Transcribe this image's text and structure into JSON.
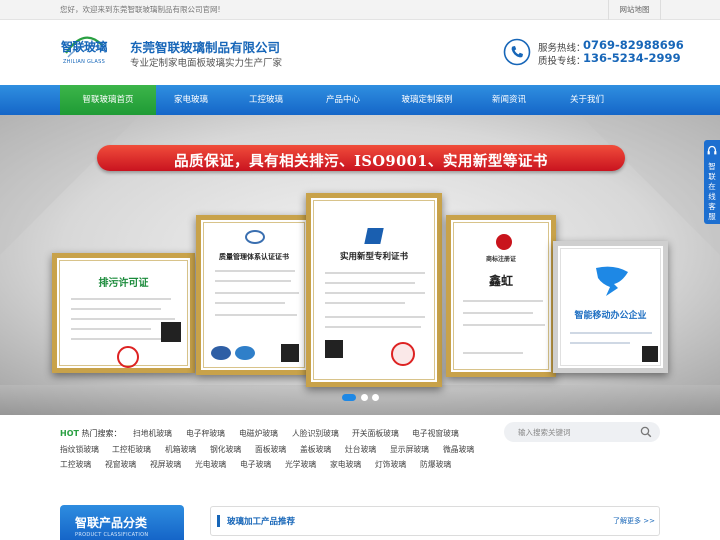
{
  "topbar": {
    "welcome": "您好，欢迎来到东莞智联玻璃制品有限公司官网!",
    "sitemap": "网站地图"
  },
  "header": {
    "logo_cn": "智联玻璃",
    "logo_en": "ZHILIAN GLASS",
    "company_name": "东莞智联玻璃制品有限公司",
    "slogan": "专业定制家电面板玻璃实力生产厂家",
    "hotline_label": "服务热线：",
    "hotline_number": "0769-82988696",
    "quality_label": "质投专线：",
    "quality_number": "136-5234-2999",
    "phone_icon": "phone-icon"
  },
  "nav": {
    "items": [
      {
        "label": "智联玻璃首页",
        "active": true
      },
      {
        "label": "家电玻璃"
      },
      {
        "label": "工控玻璃"
      },
      {
        "label": "产品中心"
      },
      {
        "label": "玻璃定制案例"
      },
      {
        "label": "新闻资讯"
      },
      {
        "label": "关于我们"
      }
    ]
  },
  "banner": {
    "title": "品质保证，具有相关排污、ISO9001、实用新型等证书",
    "certs": [
      {
        "title": "排污许可证"
      },
      {
        "title": "质量管理体系认证证书"
      },
      {
        "title": "实用新型专利证书"
      },
      {
        "title": "商标注册证",
        "mark": "鑫虹"
      },
      {
        "title": "智能移动办公企业"
      }
    ],
    "slide_count": 3,
    "active_slide": 1
  },
  "side_tab": {
    "label": "智联在线客服"
  },
  "hot_search": {
    "label_prefix": "HOT",
    "label_suffix": "热门搜索：",
    "rows": [
      [
        "扫地机玻璃",
        "电子秤玻璃",
        "电磁炉玻璃",
        "人脸识别玻璃",
        "开关面板玻璃",
        "电子视窗玻璃"
      ],
      [
        "指纹锁玻璃",
        "工控柜玻璃",
        "机箱玻璃",
        "钢化玻璃",
        "面板玻璃",
        "盖板玻璃",
        "灶台玻璃",
        "显示屏玻璃",
        "微晶玻璃"
      ],
      [
        "工控玻璃",
        "视窗玻璃",
        "视屏玻璃",
        "光电玻璃",
        "电子玻璃",
        "光学玻璃",
        "家电玻璃",
        "灯饰玻璃",
        "防爆玻璃"
      ]
    ],
    "search_placeholder": "输入搜索关键词"
  },
  "product_category": {
    "title": "智联产品分类",
    "subtitle": "PRODUCT CLASSIFICATION"
  },
  "recommend": {
    "title": "玻璃加工产品推荐",
    "more": "了解更多 >>"
  },
  "colors": {
    "brand_blue": "#1766b8",
    "nav_green": "#2aa042",
    "banner_red": "#d9232b"
  }
}
